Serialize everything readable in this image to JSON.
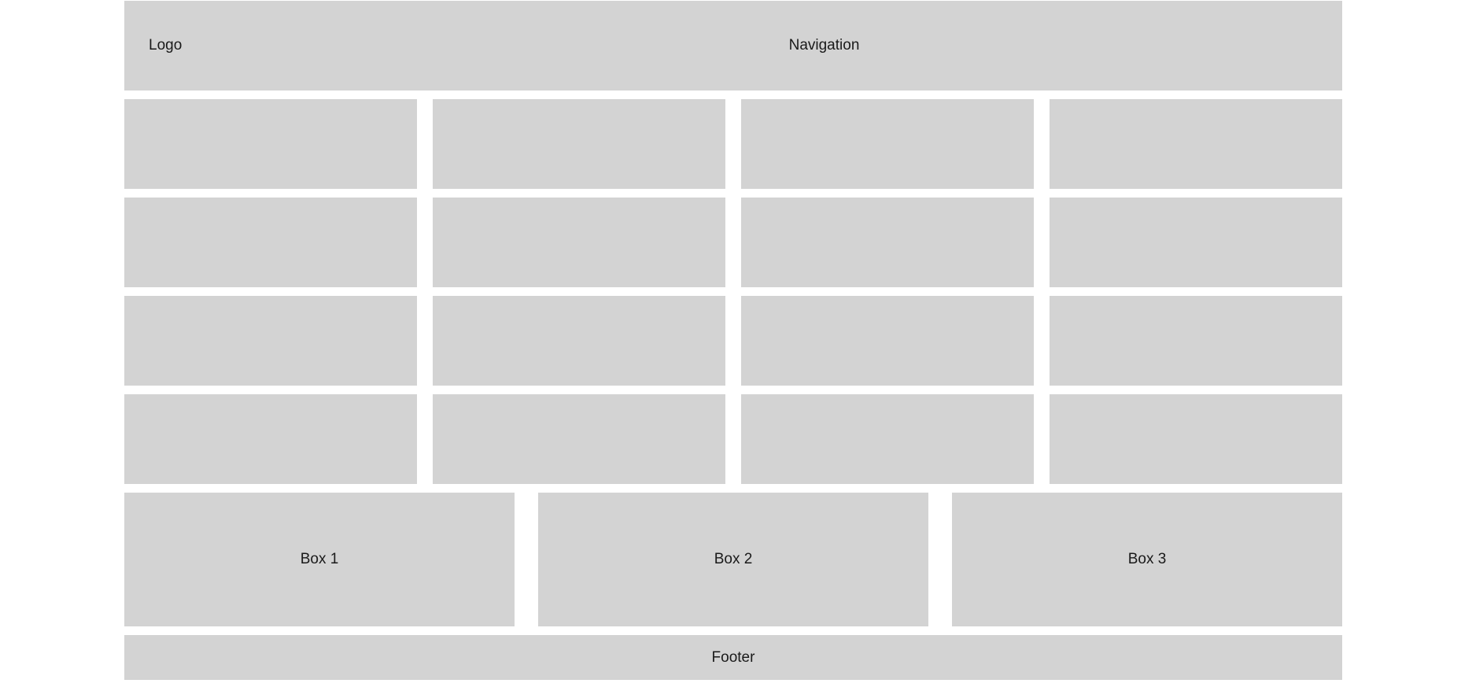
{
  "header": {
    "logo": "Logo",
    "navigation": "Navigation"
  },
  "grid": {
    "rows": 4,
    "columns": 4,
    "tiles": [
      "",
      "",
      "",
      "",
      "",
      "",
      "",
      "",
      "",
      "",
      "",
      "",
      "",
      "",
      "",
      ""
    ]
  },
  "boxes": [
    {
      "label": "Box 1"
    },
    {
      "label": "Box 2"
    },
    {
      "label": "Box 3"
    }
  ],
  "footer": {
    "label": "Footer"
  },
  "colors": {
    "block": "#d3d3d3",
    "background": "#ffffff",
    "text": "#1a1a1a"
  }
}
